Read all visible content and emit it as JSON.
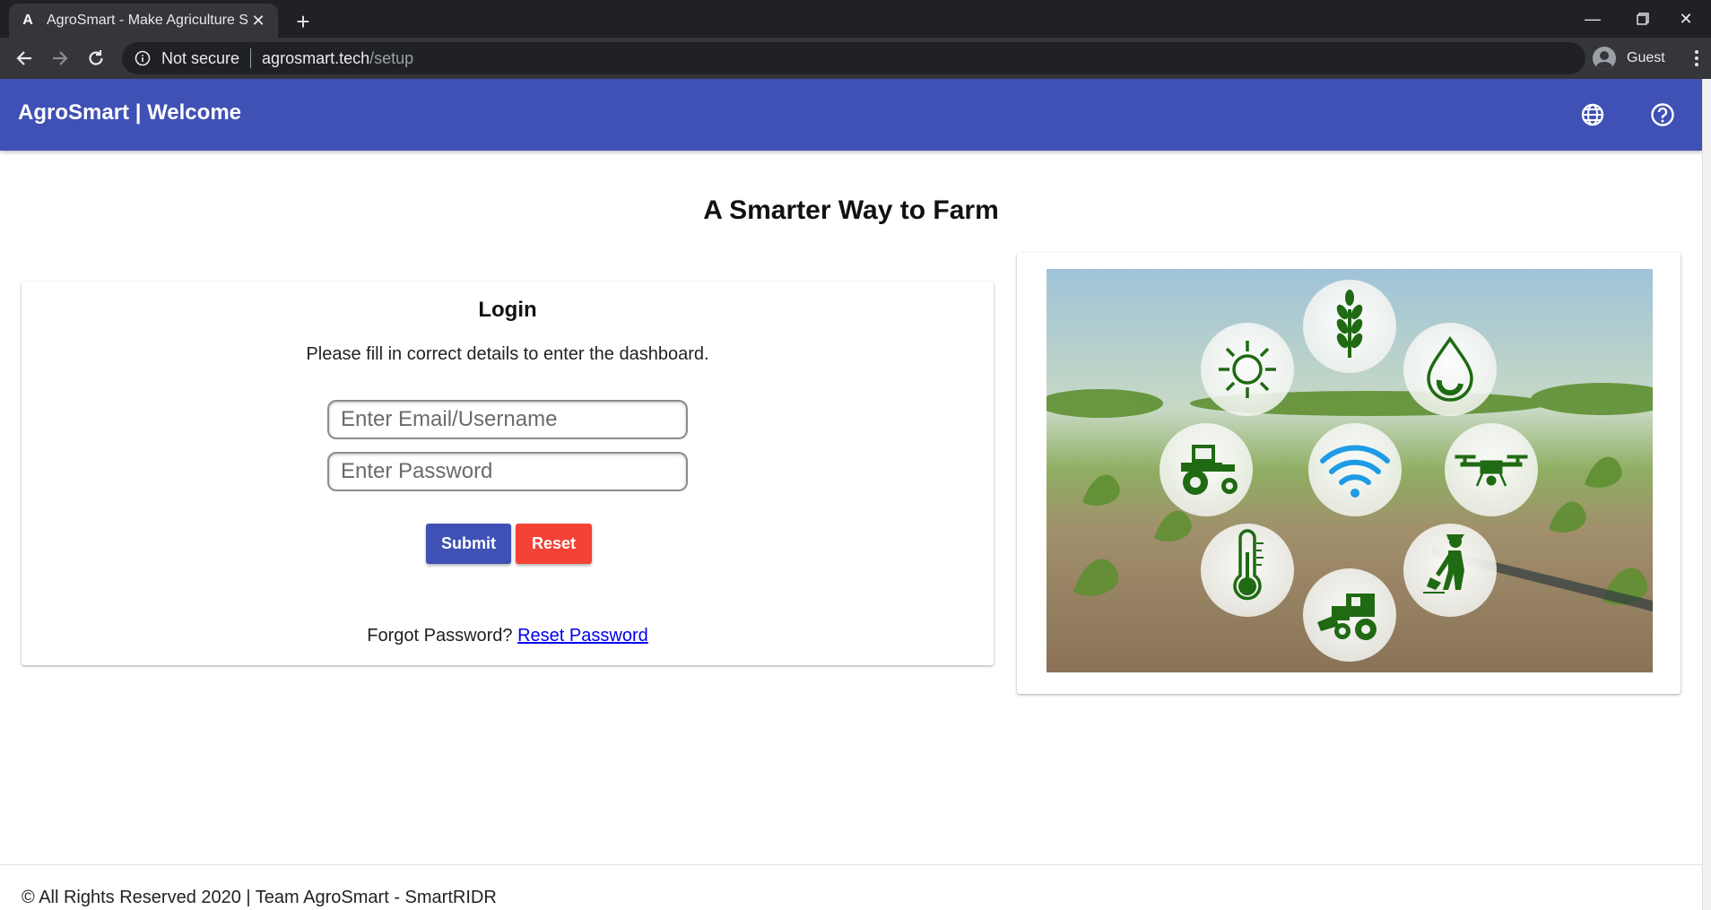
{
  "browser": {
    "tab_title": "AgroSmart - Make Agriculture Sr",
    "favicon_letter": "A",
    "security_label": "Not secure",
    "url_host": "agrosmart.tech",
    "url_path": "/setup",
    "profile_label": "Guest"
  },
  "header": {
    "title": "AgroSmart | Welcome",
    "background": "#3f51b5",
    "icons": [
      "globe-icon",
      "help-icon"
    ]
  },
  "main": {
    "headline": "A Smarter Way to Farm",
    "login": {
      "title": "Login",
      "subtitle": "Please fill in correct details to enter the dashboard.",
      "email_placeholder": "Enter Email/Username",
      "password_placeholder": "Enter Password",
      "submit_label": "Submit",
      "reset_label": "Reset",
      "forgot_text": "Forgot Password?",
      "reset_link": "Reset Password",
      "submit_color": "#3f51b5",
      "reset_color": "#f44336"
    },
    "hero_image": {
      "icons": [
        "sun-icon",
        "wheat-icon",
        "water-drop-icon",
        "tractor-icon",
        "wifi-icon",
        "drone-icon",
        "thermometer-icon",
        "harvester-icon",
        "farmer-icon"
      ]
    }
  },
  "footer": {
    "text": "© All Rights Reserved 2020 | Team AgroSmart - SmartRIDR"
  }
}
